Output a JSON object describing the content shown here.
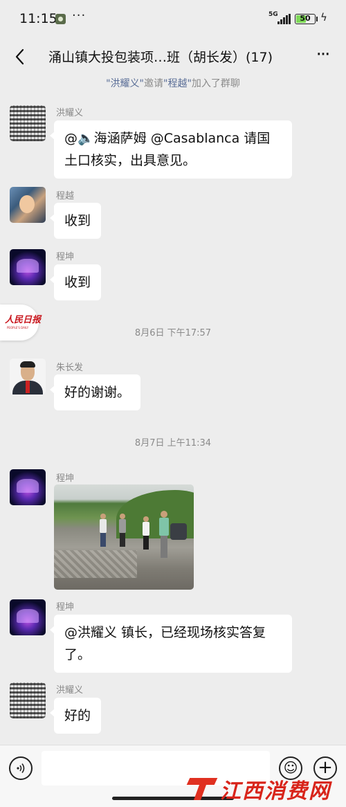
{
  "status_bar": {
    "time": "11:15",
    "dots": "···",
    "network": "5G",
    "battery": "50",
    "battery_level": 0.5,
    "accent_battery": "#7ed957"
  },
  "nav": {
    "back_icon": "back-chevron-icon",
    "title": "涌山镇大投包装项…班（胡长发）(17)",
    "more_icon": "more-icon"
  },
  "system_notice": {
    "inviter": "\"洪耀义\"",
    "invite_word": "邀请",
    "invitee": "\"程越\"",
    "joined": "加入了群聊"
  },
  "messages": [
    {
      "sender": "洪耀义",
      "text": "@🔈海涵萨姆 @Casablanca 请国土口核实，出具意见。"
    },
    {
      "sender": "程越",
      "text": "收到"
    },
    {
      "sender": "程坤",
      "text": "收到"
    },
    {
      "sender": "朱长发",
      "text": "好的谢谢。"
    },
    {
      "sender": "程坤",
      "text": ""
    },
    {
      "sender": "程坤",
      "text": "@洪耀义  镇长，已经现场核实答复了。"
    },
    {
      "sender": "洪耀义",
      "text": "好的"
    }
  ],
  "time_dividers": [
    "8月6日 下午17:57",
    "8月7日 上午11:34"
  ],
  "floating_badge": {
    "logo_text": "人民日报",
    "sub_text": "PEOPLE'S DAILY"
  },
  "bottom_bar": {
    "voice_icon": "voice-icon",
    "emoji_icon": "emoji-icon",
    "plus_icon": "plus-icon"
  },
  "watermark": {
    "text": "江西消费网"
  },
  "colors": {
    "background": "#ededed",
    "bubble": "#ffffff",
    "link": "#576b95",
    "brand_red": "#c8161d"
  }
}
